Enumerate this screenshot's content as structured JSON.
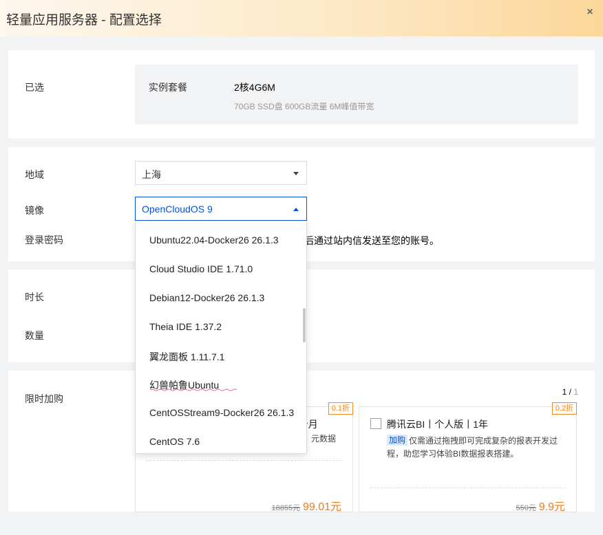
{
  "dialog": {
    "title": "轻量应用服务器 - 配置选择",
    "close_glyph": "×"
  },
  "selected": {
    "label": "已选",
    "plan_label": "实例套餐",
    "plan_value": "2核4G6M",
    "plan_desc": "70GB SSD盘 600GB流量 6M峰值带宽"
  },
  "config": {
    "region_label": "地域",
    "region_value": "上海",
    "image_label": "镜像",
    "image_value": "OpenCloudOS 9",
    "password_label": "登录密码",
    "password_hint": "后通过站内信发送至您的账号。"
  },
  "image_dropdown": {
    "options": [
      "Ubuntu22.04-Docker26 26.1.3",
      "Cloud Studio IDE 1.71.0",
      "Debian12-Docker26 26.1.3",
      "Theia IDE 1.37.2",
      "翼龙面板 1.11.7.1",
      "幻兽帕鲁Ubuntu",
      "CentOSStream9-Docker26 26.1.3",
      "CentOS 7.6"
    ]
  },
  "purchase": {
    "duration_label": "时长",
    "quantity_label": "数量"
  },
  "addons": {
    "label": "限时加购",
    "pager_current": "1",
    "pager_sep": " / ",
    "pager_total": "1",
    "items": [
      {
        "badge": "0.1折",
        "title_fragment": "3个月",
        "desc_fragment": "元数据",
        "old_price": "18855元",
        "new_price": "99.01元"
      },
      {
        "badge": "0.2折",
        "title": "腾讯云BI丨个人版丨1年",
        "tag": "加购",
        "desc": "仅需通过拖拽即可完成复杂的报表开发过程，助您学习体验BI数据报表搭建。",
        "old_price": "550元",
        "new_price": "9.9元"
      }
    ]
  },
  "colors": {
    "accent": "#0052d9",
    "discount_orange": "#f08a24",
    "price_orange": "#f07a18"
  }
}
